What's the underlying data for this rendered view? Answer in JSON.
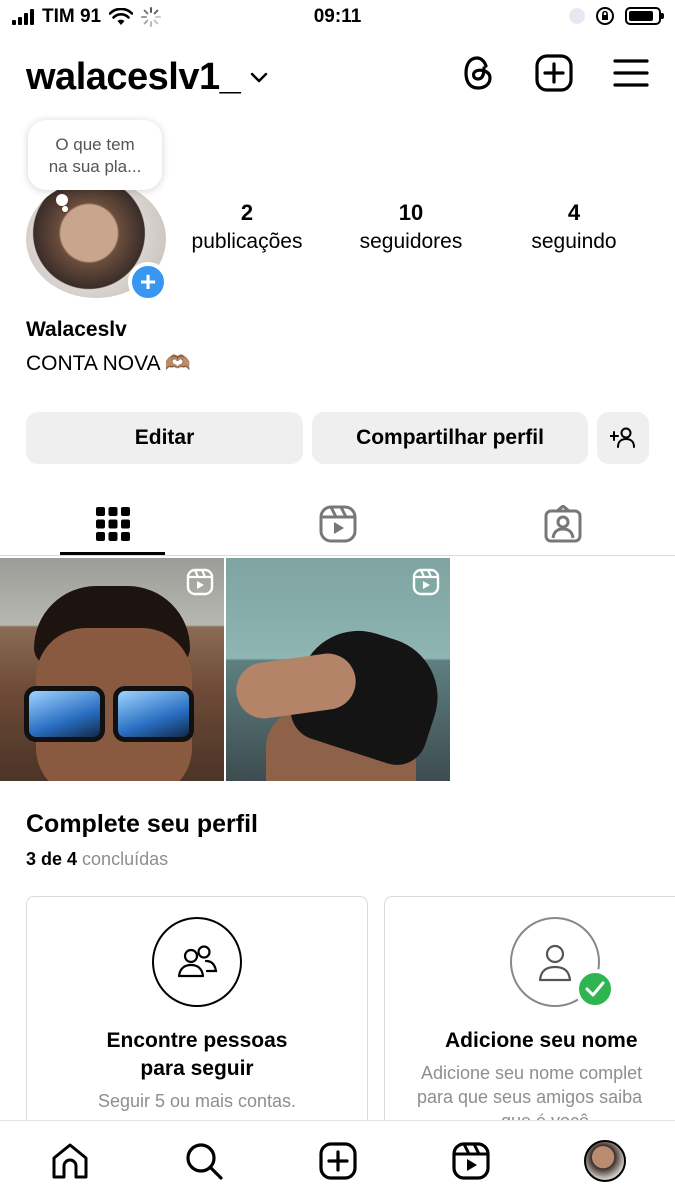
{
  "status_bar": {
    "carrier": "TIM 91",
    "time": "09:11"
  },
  "header": {
    "username": "walaceslv1_"
  },
  "note": {
    "text_line1": "O que tem",
    "text_line2": "na sua pla..."
  },
  "stats": {
    "posts": {
      "value": "2",
      "label": "publicações"
    },
    "followers": {
      "value": "10",
      "label": "seguidores"
    },
    "following": {
      "value": "4",
      "label": "seguindo"
    }
  },
  "profile": {
    "name": "Walaceslv",
    "bio": "CONTA NOVA",
    "bio_emoji": "🫶🏽"
  },
  "buttons": {
    "edit": "Editar",
    "share": "Compartilhar perfil"
  },
  "complete_profile": {
    "title": "Complete seu perfil",
    "progress_bold": "3 de 4",
    "progress_rest": "concluídas",
    "cards": [
      {
        "title_line1": "Encontre pessoas",
        "title_line2": "para seguir",
        "text_line1": "Seguir 5 ou mais contas."
      },
      {
        "title_line1": "Adicione seu nome",
        "text_line1": "Adicione seu nome complet",
        "text_line2": "para que seus amigos saiba",
        "text_line3": "que é você."
      }
    ]
  },
  "colors": {
    "accent_blue": "#3897f0",
    "success_green": "#2fb550",
    "button_bg": "#efefef"
  }
}
